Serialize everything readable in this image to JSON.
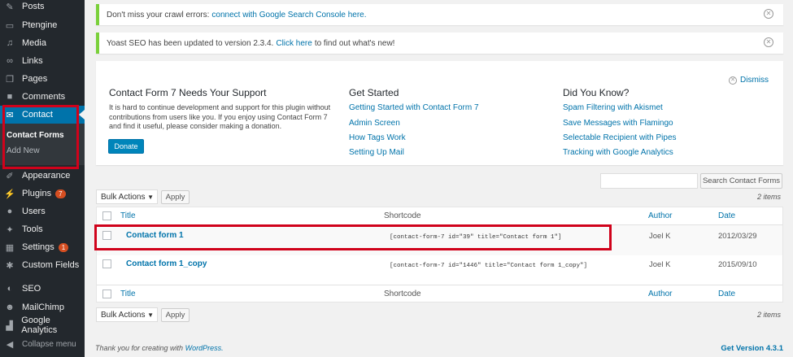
{
  "sidebar": {
    "items": [
      {
        "label": "Posts",
        "icon": "pushpin-icon"
      },
      {
        "label": "Ptengine",
        "icon": "page-icon"
      },
      {
        "label": "Media",
        "icon": "media-icon"
      },
      {
        "label": "Links",
        "icon": "link-icon"
      },
      {
        "label": "Pages",
        "icon": "pages-icon"
      },
      {
        "label": "Comments",
        "icon": "comment-icon"
      },
      {
        "label": "Contact",
        "icon": "mail-icon"
      },
      {
        "label": "Appearance",
        "icon": "paintbrush-icon"
      },
      {
        "label": "Plugins",
        "icon": "plugin-icon",
        "badge": "7"
      },
      {
        "label": "Users",
        "icon": "users-icon"
      },
      {
        "label": "Tools",
        "icon": "wrench-icon"
      },
      {
        "label": "Settings",
        "icon": "settings-icon",
        "badge": "1"
      },
      {
        "label": "Custom Fields",
        "icon": "gear-icon"
      },
      {
        "label": "SEO",
        "icon": "yoast-icon"
      },
      {
        "label": "MailChimp",
        "icon": "mailchimp-icon"
      },
      {
        "label": "Google Analytics",
        "icon": "chart-icon"
      }
    ],
    "submenu": {
      "active": "Contact Forms",
      "add_new": "Add New"
    },
    "collapse": "Collapse menu"
  },
  "notices": {
    "crawl_text": "Don't miss your crawl errors:",
    "crawl_link": "connect with Google Search Console here.",
    "yoast_text": "Yoast SEO has been updated to version 2.3.4.",
    "yoast_link": "Click here",
    "yoast_text_after": "to find out what's new!"
  },
  "welcome": {
    "support_title": "Contact Form 7 Needs Your Support",
    "support_text": "It is hard to continue development and support for this plugin without contributions from users like you. If you enjoy using Contact Form 7 and find it useful, please consider making a donation.",
    "donate": "Donate",
    "started_title": "Get Started",
    "started_links": [
      "Getting Started with Contact Form 7",
      "Admin Screen",
      "How Tags Work",
      "Setting Up Mail"
    ],
    "know_title": "Did You Know?",
    "know_links": [
      "Spam Filtering with Akismet",
      "Save Messages with Flamingo",
      "Selectable Recipient with Pipes",
      "Tracking with Google Analytics"
    ],
    "dismiss": "Dismiss"
  },
  "search": {
    "button": "Search Contact Forms"
  },
  "bulk": {
    "select": "Bulk Actions",
    "apply": "Apply",
    "count": "2 items"
  },
  "table": {
    "headers": {
      "title": "Title",
      "shortcode": "Shortcode",
      "author": "Author",
      "date": "Date"
    },
    "rows": [
      {
        "title": "Contact form 1",
        "shortcode": "[contact-form-7 id=\"39\" title=\"Contact form 1\"]",
        "author": "Joel K",
        "date": "2012/03/29"
      },
      {
        "title": "Contact form 1_copy",
        "shortcode": "[contact-form-7 id=\"1446\" title=\"Contact form 1_copy\"]",
        "author": "Joel K",
        "date": "2015/09/10"
      }
    ]
  },
  "footer": {
    "thanks": "Thank you for creating with",
    "wp": "WordPress.",
    "version": "Get Version 4.3.1"
  },
  "colors": {
    "accent": "#0073aa",
    "highlight": "#d0021b",
    "sidebar": "#23282d"
  }
}
